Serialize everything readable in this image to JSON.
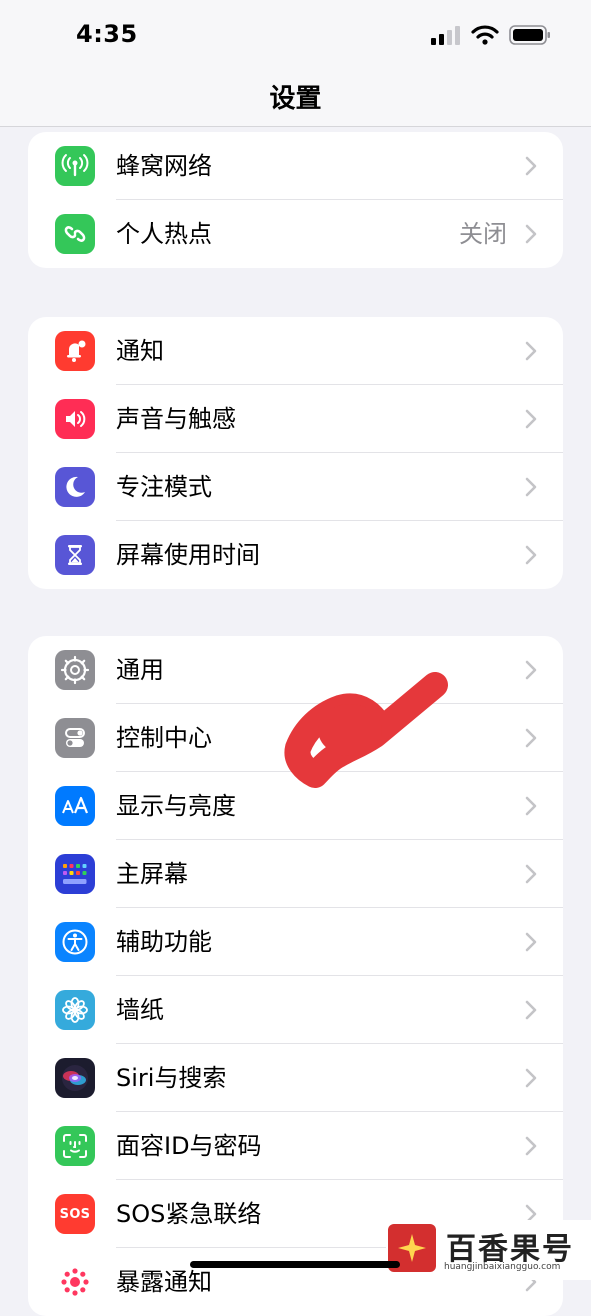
{
  "status_bar": {
    "time": "4:35"
  },
  "nav": {
    "title": "设置"
  },
  "groups": [
    {
      "rows": [
        {
          "label": "蜂窝网络",
          "icon": "cellular-antenna-icon",
          "color": "#34c759"
        },
        {
          "label": "个人热点",
          "value": "关闭",
          "icon": "hotspot-chain-icon",
          "color": "#34c759"
        }
      ]
    },
    {
      "rows": [
        {
          "label": "通知",
          "icon": "notification-bell-icon",
          "color": "#ff3b30"
        },
        {
          "label": "声音与触感",
          "icon": "speaker-icon",
          "color": "#ff2d55"
        },
        {
          "label": "专注模式",
          "icon": "moon-icon",
          "color": "#5856d6"
        },
        {
          "label": "屏幕使用时间",
          "icon": "hourglass-icon",
          "color": "#5856d6"
        }
      ]
    },
    {
      "rows": [
        {
          "label": "通用",
          "icon": "gear-icon",
          "color": "#8e8e93"
        },
        {
          "label": "控制中心",
          "icon": "toggles-icon",
          "color": "#8e8e93"
        },
        {
          "label": "显示与亮度",
          "icon": "text-size-icon",
          "color": "#007aff"
        },
        {
          "label": "主屏幕",
          "icon": "app-grid-icon",
          "color": "#2c3ed6"
        },
        {
          "label": "辅助功能",
          "icon": "accessibility-icon",
          "color": "#0a84ff"
        },
        {
          "label": "墙纸",
          "icon": "flower-icon",
          "color": "#35aadc"
        },
        {
          "label": "Siri与搜索",
          "icon": "siri-icon",
          "color": "#1c1c2e"
        },
        {
          "label": "面容ID与密码",
          "icon": "face-id-icon",
          "color": "#34c759"
        },
        {
          "label": "SOS紧急联络",
          "icon": "sos-icon",
          "color": "#ff3b30",
          "icon_text": "SOS"
        },
        {
          "label": "暴露通知",
          "icon": "exposure-icon",
          "color": "#ffffff"
        }
      ]
    }
  ],
  "watermark": {
    "name": "百香果号",
    "url": "huangjinbaixiangguo.com"
  },
  "colors": {
    "chevron": "#c4c4c7",
    "accent_scribble": "#e5383b"
  }
}
